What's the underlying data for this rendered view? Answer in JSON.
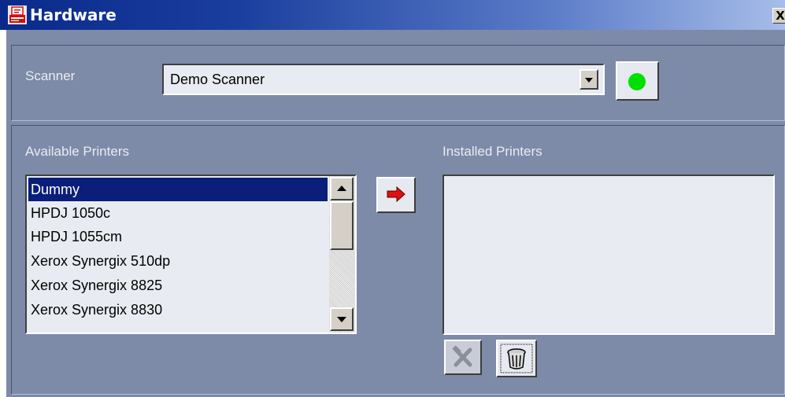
{
  "window": {
    "title": "Hardware",
    "close_glyph": "X",
    "app_icon": "printer-app-icon"
  },
  "scanner": {
    "label": "Scanner",
    "selected": "Demo Scanner",
    "status_color": "#00e000"
  },
  "available": {
    "label": "Available Printers",
    "items": [
      "Dummy",
      "HPDJ 1050c",
      "HPDJ 1055cm",
      "Xerox Synergix 510dp",
      "Xerox Synergix 8825",
      "Xerox Synergix 8830"
    ],
    "selected_index": 0
  },
  "installed": {
    "label": "Installed Printers",
    "items": []
  },
  "icons": {
    "add": "right-arrow-icon",
    "configure": "tools-icon",
    "remove": "trash-icon"
  },
  "colors": {
    "panel": "#7d8ba8",
    "selection": "#0a1e7a",
    "arrow": "#e01010"
  }
}
